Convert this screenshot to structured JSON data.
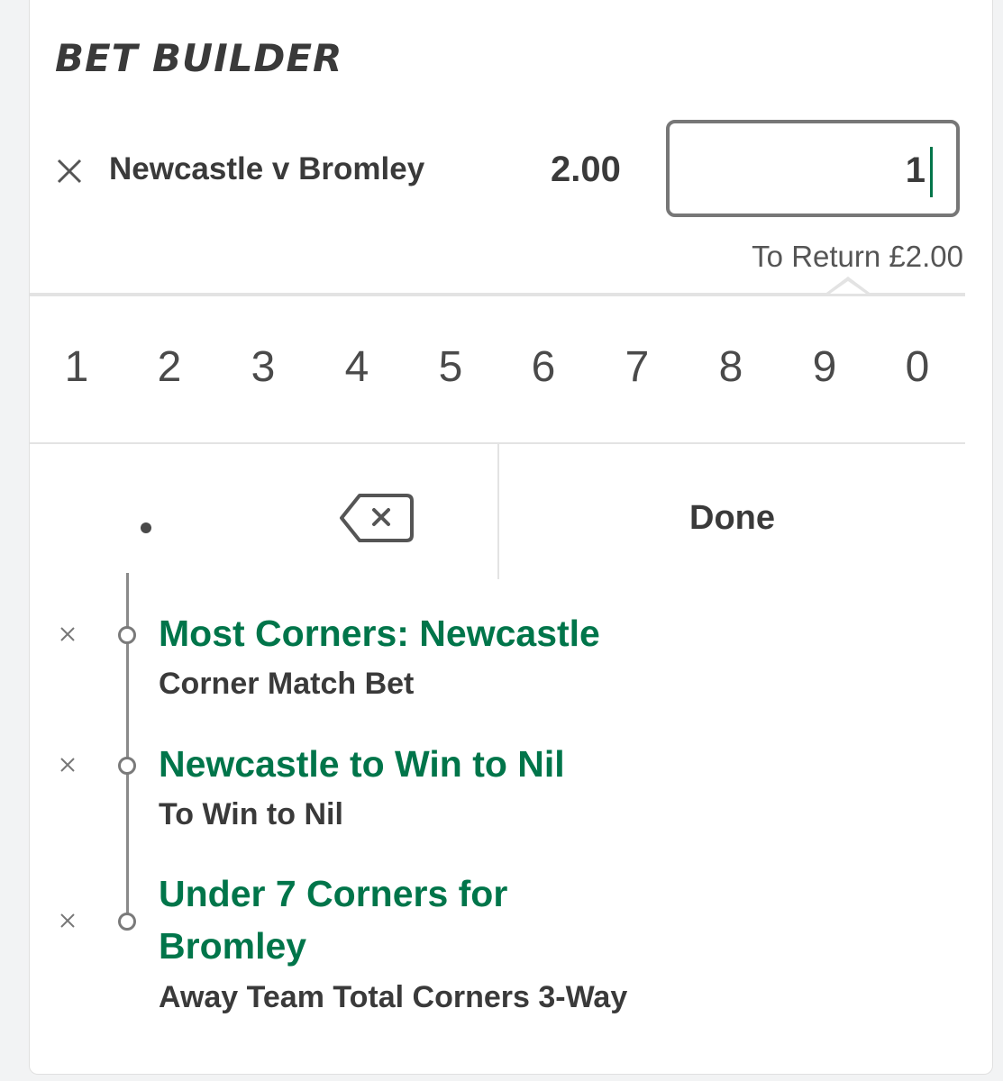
{
  "header": {
    "title": "BET BUILDER"
  },
  "bet": {
    "remove_icon": "close-icon",
    "match": "Newcastle v Bromley",
    "odds": "2.00",
    "stake": "1",
    "to_return": "To Return £2.00"
  },
  "keypad": {
    "digits": [
      "1",
      "2",
      "3",
      "4",
      "5",
      "6",
      "7",
      "8",
      "9",
      "0"
    ],
    "decimal_icon": "decimal-point-icon",
    "backspace_icon": "backspace-icon",
    "done_label": "Done"
  },
  "selections": [
    {
      "name": "Most Corners: Newcastle",
      "market": "Corner Match Bet"
    },
    {
      "name": "Newcastle to Win to Nil",
      "market": "To Win to Nil"
    },
    {
      "name": "Under 7 Corners for Bromley",
      "market": "Away Team Total Corners 3-Way"
    }
  ],
  "colors": {
    "selection_green": "#00754a",
    "text_dark": "#3a3a3a",
    "divider": "#e3e3e3"
  }
}
